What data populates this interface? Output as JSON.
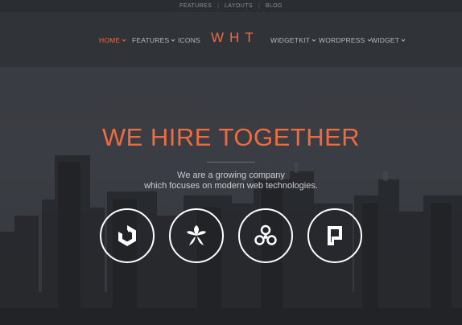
{
  "topbar": {
    "links": [
      "FEATURES",
      "LAYOUTS",
      "BLOG"
    ]
  },
  "nav": {
    "logo": "WHT",
    "left": [
      {
        "label": "HOME",
        "active": true,
        "dropdown": true
      },
      {
        "label": "FEATURES",
        "active": false,
        "dropdown": true
      },
      {
        "label": "ICONS",
        "active": false,
        "dropdown": false
      }
    ],
    "right": [
      {
        "label": "WIDGETKIT",
        "dropdown": true
      },
      {
        "label": "WORDPRESS",
        "dropdown": true
      },
      {
        "label": "WIDGET",
        "dropdown": true
      }
    ]
  },
  "hero": {
    "headline": "WE HIRE TOGETHER",
    "subtitle_line1": "We are a growing company",
    "subtitle_line2": "which focuses on modern web technologies.",
    "icons": [
      "uikit-logo-icon",
      "bamboo-leaf-icon",
      "molecule-icon",
      "page-document-icon"
    ]
  },
  "colors": {
    "accent": "#ee6a3f",
    "background": "#2f3237",
    "text_light": "#c9ccd1"
  }
}
